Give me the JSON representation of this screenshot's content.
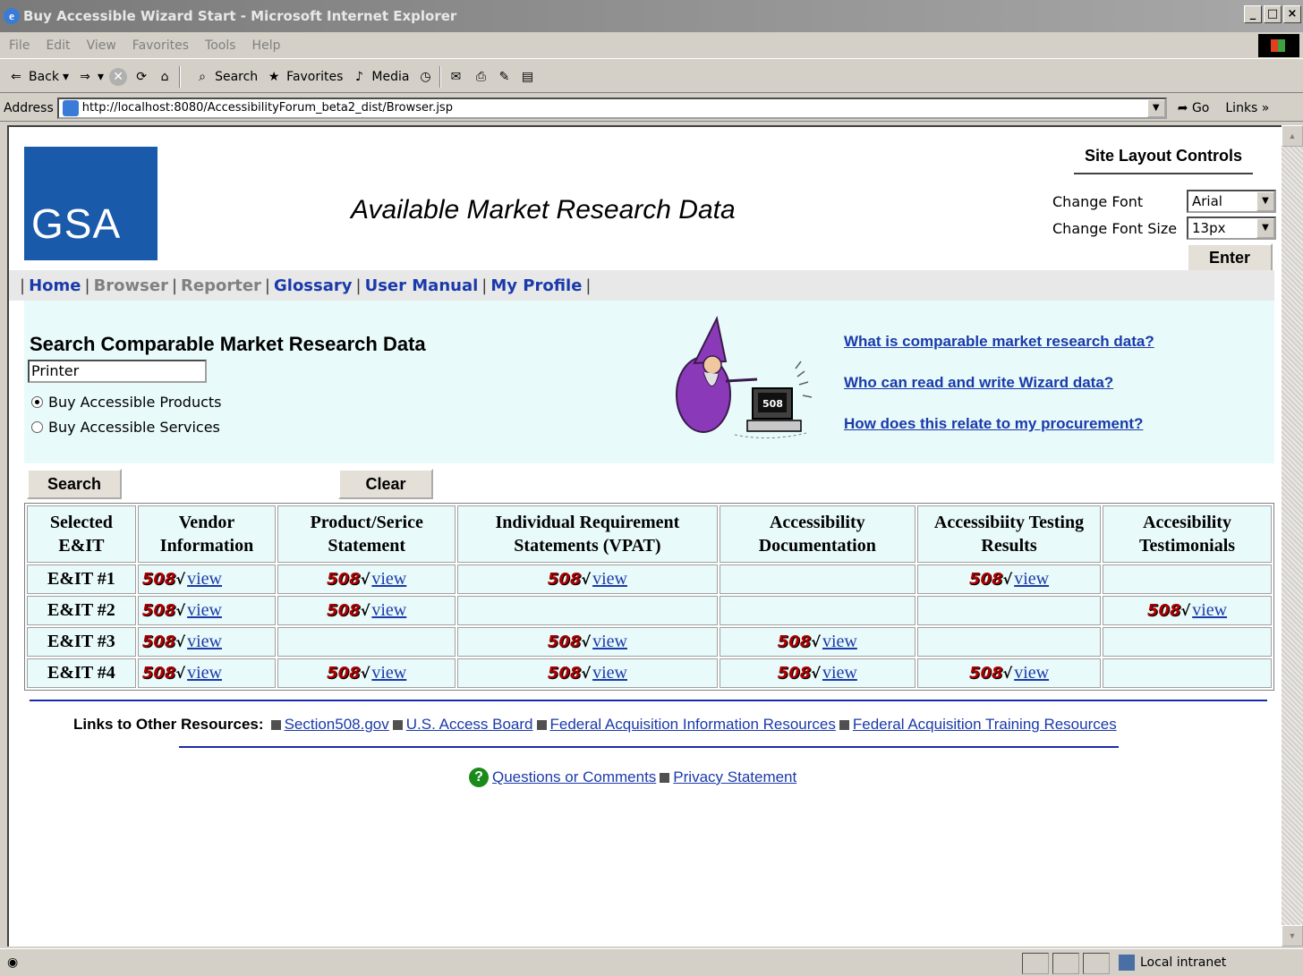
{
  "window": {
    "title": "Buy Accessible Wizard Start - Microsoft Internet Explorer",
    "controls": [
      "_",
      "□",
      "×"
    ]
  },
  "menu": [
    "File",
    "Edit",
    "View",
    "Favorites",
    "Tools",
    "Help"
  ],
  "toolbar": {
    "back": "Back",
    "search": "Search",
    "favorites": "Favorites",
    "media": "Media"
  },
  "address": {
    "label": "Address",
    "url": "http://localhost:8080/AccessibilityForum_beta2_dist/Browser.jsp",
    "go": "Go",
    "links": "Links"
  },
  "page": {
    "logo_text": "GSA",
    "title": "Available Market Research Data",
    "layout_controls": {
      "title": "Site Layout Controls",
      "font_label": "Change Font",
      "font_value": "Arial",
      "size_label": "Change Font Size",
      "size_value": "13px",
      "enter": "Enter"
    },
    "nav": [
      {
        "label": "Home",
        "active": true
      },
      {
        "label": "Browser",
        "active": false
      },
      {
        "label": "Reporter",
        "active": false
      },
      {
        "label": "Glossary",
        "active": true
      },
      {
        "label": "User Manual",
        "active": true
      },
      {
        "label": "My Profile",
        "active": true
      }
    ],
    "search": {
      "heading": "Search Comparable Market Research Data",
      "query": "Printer",
      "options": [
        {
          "label": "Buy Accessible Products",
          "selected": true
        },
        {
          "label": "Buy Accessible Services",
          "selected": false
        }
      ],
      "search_button": "Search",
      "clear_button": "Clear"
    },
    "help_links": [
      "What is comparable market research data?",
      "Who can read and write Wizard data?",
      "How does this relate to my procurement?"
    ],
    "table": {
      "headers": [
        [
          "Selected",
          "E&IT"
        ],
        [
          "Vendor",
          "Information"
        ],
        [
          "Product/Serice",
          "Statement"
        ],
        [
          "Individual Requirement",
          "Statements (VPAT)"
        ],
        [
          "Accessibility",
          "Documentation"
        ],
        [
          "Accessibiity Testing",
          "Results"
        ],
        [
          "Accesibility",
          "Testimonials"
        ]
      ],
      "badge": "508",
      "check": "√",
      "view": "view",
      "rows": [
        {
          "label": "E&IT #1",
          "cells": [
            true,
            true,
            true,
            false,
            true,
            false
          ]
        },
        {
          "label": "E&IT #2",
          "cells": [
            true,
            true,
            false,
            false,
            false,
            true
          ]
        },
        {
          "label": "E&IT #3",
          "cells": [
            true,
            false,
            true,
            true,
            false,
            false
          ]
        },
        {
          "label": "E&IT #4",
          "cells": [
            true,
            true,
            true,
            true,
            true,
            false
          ]
        }
      ]
    },
    "resources": {
      "label": "Links to Other Resources:",
      "links": [
        "Section508.gov",
        "U.S. Access Board",
        "Federal Acquisition Information Resources",
        "Federal Acquisition Training Resources"
      ]
    },
    "footer": {
      "questions": "Questions or Comments",
      "privacy": "Privacy Statement"
    }
  },
  "status": {
    "zone": "Local intranet"
  }
}
